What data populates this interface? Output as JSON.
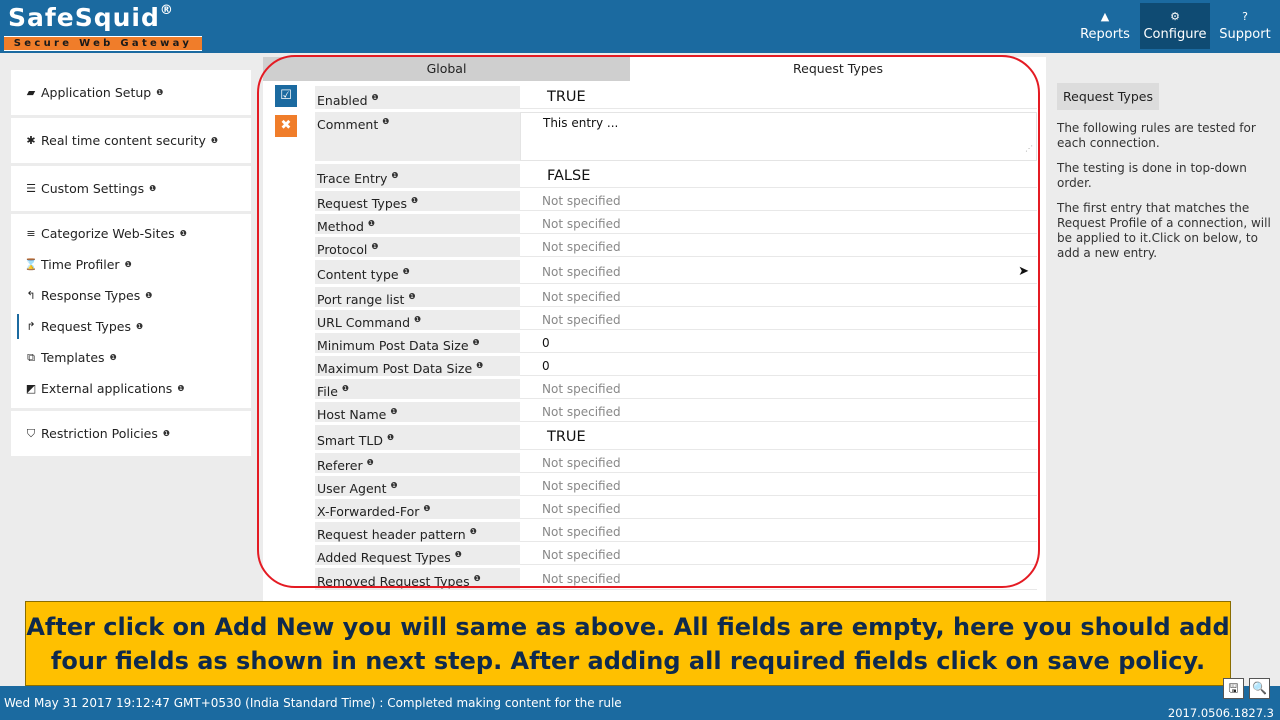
{
  "header": {
    "logo_title": "SafeSquid",
    "logo_reg": "®",
    "logo_tagline": "Secure Web Gateway",
    "nav": [
      {
        "label": "Reports",
        "icon": "▲"
      },
      {
        "label": "Configure",
        "icon": "⚙"
      },
      {
        "label": "Support",
        "icon": "?"
      }
    ]
  },
  "sidebar": {
    "groups": [
      [
        {
          "label": "Application Setup",
          "icon": "briefcase-icon",
          "glyph": "▰"
        }
      ],
      [
        {
          "label": "Real time content security",
          "icon": "bug-icon",
          "glyph": "✱"
        }
      ],
      [
        {
          "label": "Custom Settings",
          "icon": "sliders-icon",
          "glyph": "☰"
        }
      ],
      [
        {
          "label": "Categorize Web-Sites",
          "icon": "database-icon",
          "glyph": "≡"
        },
        {
          "label": "Time Profiler",
          "icon": "hourglass-icon",
          "glyph": "⌛"
        },
        {
          "label": "Response Types",
          "icon": "reply-icon",
          "glyph": "↰"
        },
        {
          "label": "Request Types",
          "icon": "share-icon",
          "glyph": "↱"
        },
        {
          "label": "Templates",
          "icon": "object-group-icon",
          "glyph": "⧉"
        },
        {
          "label": "External applications",
          "icon": "external-link-icon",
          "glyph": "◩"
        }
      ],
      [
        {
          "label": "Restriction Policies",
          "icon": "shield-icon",
          "glyph": "⛉"
        }
      ]
    ],
    "info_glyph": "❶"
  },
  "main": {
    "tabs": [
      "Global",
      "Request Types"
    ],
    "edit_icon": "☑",
    "delete_icon": "✖",
    "fields": [
      {
        "label": "Enabled",
        "value": "TRUE",
        "kind": "bool"
      },
      {
        "label": "Comment",
        "value": "This entry ...",
        "kind": "comment"
      },
      {
        "label": "Trace Entry",
        "value": "FALSE",
        "kind": "bool"
      },
      {
        "label": "Request Types",
        "value": "Not specified",
        "kind": "empty"
      },
      {
        "label": "Method",
        "value": "Not specified",
        "kind": "empty"
      },
      {
        "label": "Protocol",
        "value": "Not specified",
        "kind": "empty"
      },
      {
        "label": "Content type",
        "value": "Not specified",
        "kind": "empty",
        "send": true
      },
      {
        "label": "Port range list",
        "value": "Not specified",
        "kind": "empty"
      },
      {
        "label": "URL Command",
        "value": "Not specified",
        "kind": "empty"
      },
      {
        "label": "Minimum Post Data Size",
        "value": "0",
        "kind": "num"
      },
      {
        "label": "Maximum Post Data Size",
        "value": "0",
        "kind": "num"
      },
      {
        "label": "File",
        "value": "Not specified",
        "kind": "empty"
      },
      {
        "label": "Host Name",
        "value": "Not specified",
        "kind": "empty"
      },
      {
        "label": "Smart TLD",
        "value": "TRUE",
        "kind": "bool"
      },
      {
        "label": "Referer",
        "value": "Not specified",
        "kind": "empty"
      },
      {
        "label": "User Agent",
        "value": "Not specified",
        "kind": "empty"
      },
      {
        "label": "X-Forwarded-For",
        "value": "Not specified",
        "kind": "empty"
      },
      {
        "label": "Request header pattern",
        "value": "Not specified",
        "kind": "empty"
      },
      {
        "label": "Added Request Types",
        "value": "Not specified",
        "kind": "empty"
      },
      {
        "label": "Removed Request Types",
        "value": "Not specified",
        "kind": "empty"
      }
    ]
  },
  "help": {
    "title": "Request Types",
    "paragraphs": [
      "The following rules are tested for each connection.",
      "The testing is done in top-down order.",
      "The first entry that matches the Request Profile of a connection, will be applied to it.Click on below, to add a new entry."
    ]
  },
  "caption": {
    "text": "After click on Add New you will same as above. All fields are empty, here you should add four fields as shown in next step. After adding all required fields click on save policy."
  },
  "status": {
    "text": "Wed May 31 2017 19:12:47 GMT+0530 (India Standard Time) : Completed making content for the rule",
    "version": "2017.0506.1827.3",
    "save_icon": "🖫",
    "search_icon": "🔍"
  }
}
